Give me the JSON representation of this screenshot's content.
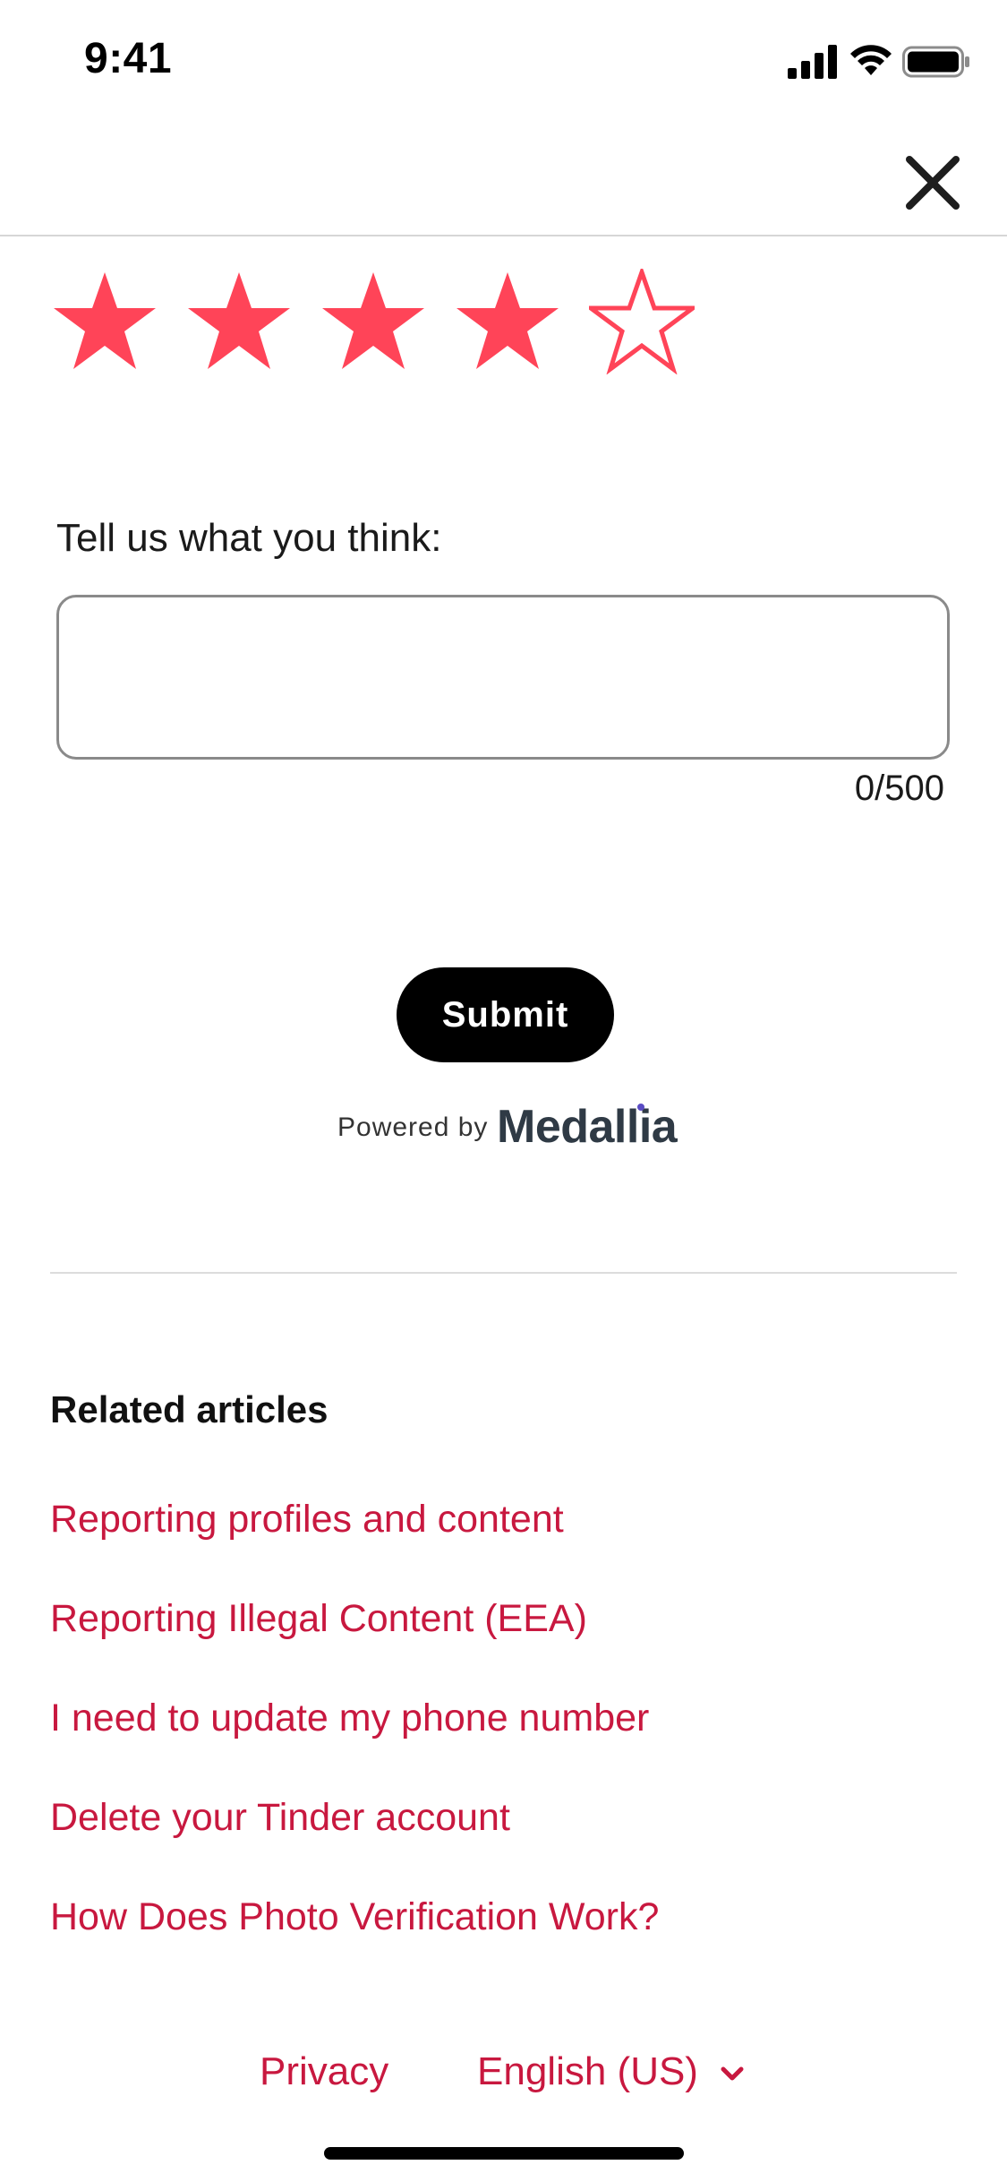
{
  "status_bar": {
    "time": "9:41"
  },
  "header": {
    "close_icon": "close-icon"
  },
  "rating": {
    "max_stars": 5,
    "value": 4,
    "color": "#ff4458"
  },
  "feedback": {
    "label": "Tell us what you think:",
    "value": "",
    "counter": "0/500"
  },
  "submit": {
    "label": "Submit"
  },
  "powered_by": {
    "label": "Powered by",
    "brand": "Medallia"
  },
  "related": {
    "heading": "Related articles",
    "articles": [
      "Reporting profiles and content",
      "Reporting Illegal Content (EEA)",
      "I need to update my phone number",
      "Delete your Tinder account",
      "How Does Photo Verification Work?"
    ]
  },
  "footer": {
    "privacy": "Privacy",
    "language": "English (US)"
  },
  "colors": {
    "accent": "#c8183f",
    "star": "#ff4458",
    "button": "#000000"
  }
}
